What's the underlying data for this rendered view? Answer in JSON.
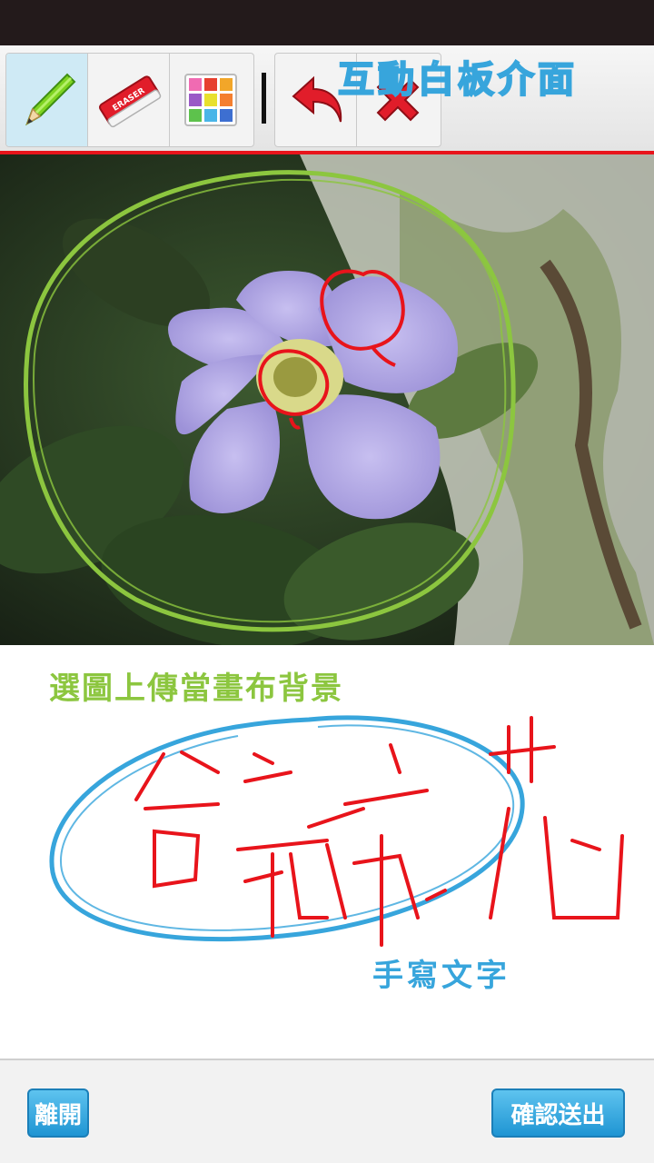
{
  "header": {
    "title": "互動白板介面"
  },
  "toolbar": {
    "tools": [
      {
        "icon": "pencil-icon",
        "active": true
      },
      {
        "icon": "eraser-icon",
        "eraser_text": "ERASER"
      },
      {
        "icon": "color-palette-icon"
      }
    ],
    "actions": [
      {
        "icon": "undo-icon"
      },
      {
        "icon": "clear-icon"
      }
    ],
    "accent_color": "#e8141b"
  },
  "canvas": {
    "annotations": {
      "upload_background": "選圖上傳當畫布背景",
      "handwritten_text": "手寫文字"
    },
    "handwriting": "台灣孤挺花",
    "stroke_colors": {
      "green": "#8cc63f",
      "red": "#e8141b",
      "blue": "#37a5dc"
    }
  },
  "footer": {
    "leave_label": "離開",
    "confirm_label": "確認送出"
  }
}
